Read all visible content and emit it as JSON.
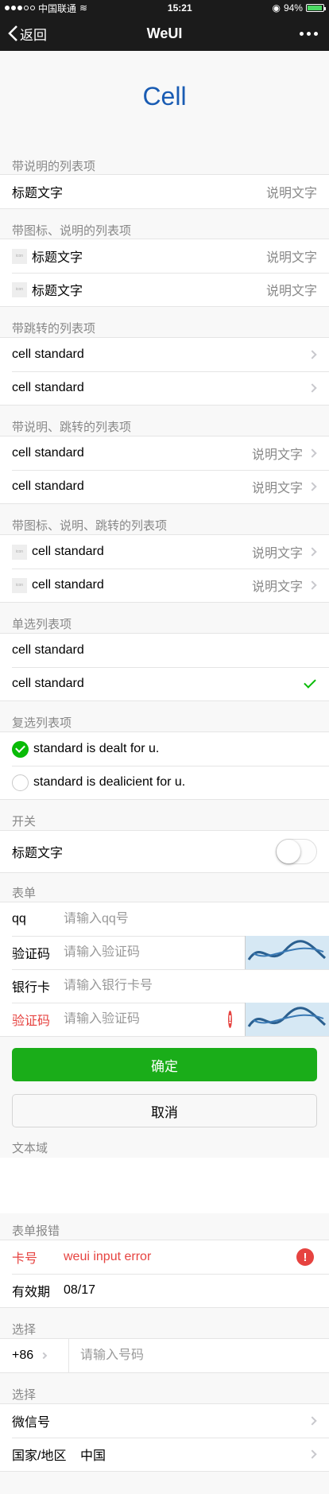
{
  "status_bar": {
    "carrier": "中国联通",
    "time": "15:21",
    "battery": "94%",
    "battery_level": 0.94
  },
  "nav": {
    "back": "返回",
    "title": "WeUI"
  },
  "page_title": "Cell",
  "sections": {
    "s1": {
      "title": "带说明的列表项",
      "cells": [
        {
          "label": "标题文字",
          "desc": "说明文字"
        }
      ]
    },
    "s2": {
      "title": "带图标、说明的列表项",
      "icon_text": "icon",
      "cells": [
        {
          "label": "标题文字",
          "desc": "说明文字"
        },
        {
          "label": "标题文字",
          "desc": "说明文字"
        }
      ]
    },
    "s3": {
      "title": "带跳转的列表项",
      "cells": [
        {
          "label": "cell standard"
        },
        {
          "label": "cell standard"
        }
      ]
    },
    "s4": {
      "title": "带说明、跳转的列表项",
      "cells": [
        {
          "label": "cell standard",
          "desc": "说明文字"
        },
        {
          "label": "cell standard",
          "desc": "说明文字"
        }
      ]
    },
    "s5": {
      "title": "带图标、说明、跳转的列表项",
      "icon_text": "icon",
      "cells": [
        {
          "label": "cell standard",
          "desc": "说明文字"
        },
        {
          "label": "cell standard",
          "desc": "说明文字"
        }
      ]
    },
    "s6": {
      "title": "单选列表项",
      "cells": [
        {
          "label": "cell standard",
          "checked": false
        },
        {
          "label": "cell standard",
          "checked": true
        }
      ]
    },
    "s7": {
      "title": "复选列表项",
      "cells": [
        {
          "label": "standard is dealt for u.",
          "checked": true
        },
        {
          "label": "standard is dealicient for u.",
          "checked": false
        }
      ]
    },
    "s8": {
      "title": "开关",
      "cells": [
        {
          "label": "标题文字",
          "on": false
        }
      ]
    },
    "s9": {
      "title": "表单",
      "rows": [
        {
          "label": "qq",
          "placeholder": "请输入qq号"
        },
        {
          "label": "验证码",
          "placeholder": "请输入验证码"
        },
        {
          "label": "银行卡",
          "placeholder": "请输入银行卡号"
        },
        {
          "label": "验证码",
          "placeholder": "请输入验证码"
        }
      ]
    },
    "buttons": {
      "primary": "确定",
      "default": "取消"
    },
    "s10": {
      "title": "文本域"
    },
    "s11": {
      "title": "表单报错",
      "rows": [
        {
          "label": "卡号",
          "value": "weui input error"
        },
        {
          "label": "有效期",
          "value": "08/17"
        }
      ]
    },
    "s12": {
      "title": "选择",
      "prefix": "+86",
      "placeholder": "请输入号码"
    },
    "s13": {
      "title": "选择",
      "rows": [
        {
          "label": "微信号",
          "value": ""
        },
        {
          "label": "国家/地区",
          "value": "中国"
        }
      ]
    }
  },
  "colors": {
    "primary": "#1aad19",
    "warn": "#e64340",
    "title_blue": "#1a5cb3",
    "nav_bg": "#1b1b1b"
  }
}
